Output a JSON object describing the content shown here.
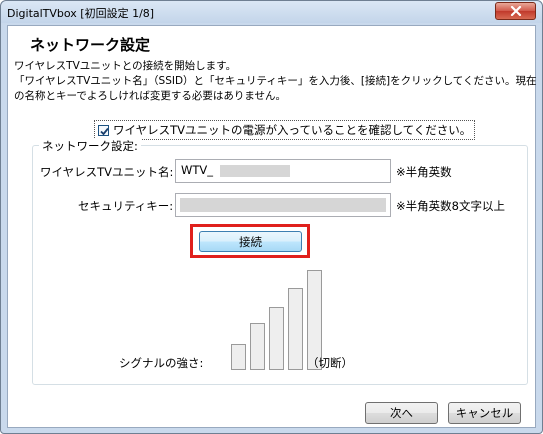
{
  "window": {
    "title": "DigitalTVbox [初回設定 1/8]"
  },
  "page": {
    "heading": "ネットワーク設定",
    "description": [
      "ワイヤレスTVユニットとの接続を開始します。",
      "「ワイヤレスTVユニット名」（SSID）と「セキュリティキー」を入力後、[接続]をクリックしてください。現在",
      "の名称とキーでよろしければ変更する必要はありません。"
    ],
    "confirm_checkbox": {
      "label": "ワイヤレスTVユニットの電源が入っていることを確認してください。",
      "checked": true
    }
  },
  "network_group": {
    "legend": "ネットワーク設定:",
    "unit_name": {
      "label": "ワイヤレスTVユニット名:",
      "value": "WTV_",
      "hint": "※半角英数"
    },
    "security_key": {
      "label": "セキュリティキー:",
      "value": "",
      "hint": "※半角英数8文字以上"
    },
    "connect_label": "接続",
    "signal": {
      "label": "シグナルの強さ:",
      "status": "（切断）",
      "level_bars": 0,
      "total_bars": 5
    }
  },
  "footer": {
    "next_label": "次へ",
    "cancel_label": "キャンセル"
  },
  "colors": {
    "highlight": "#e0201c",
    "close": "#c0392b"
  }
}
